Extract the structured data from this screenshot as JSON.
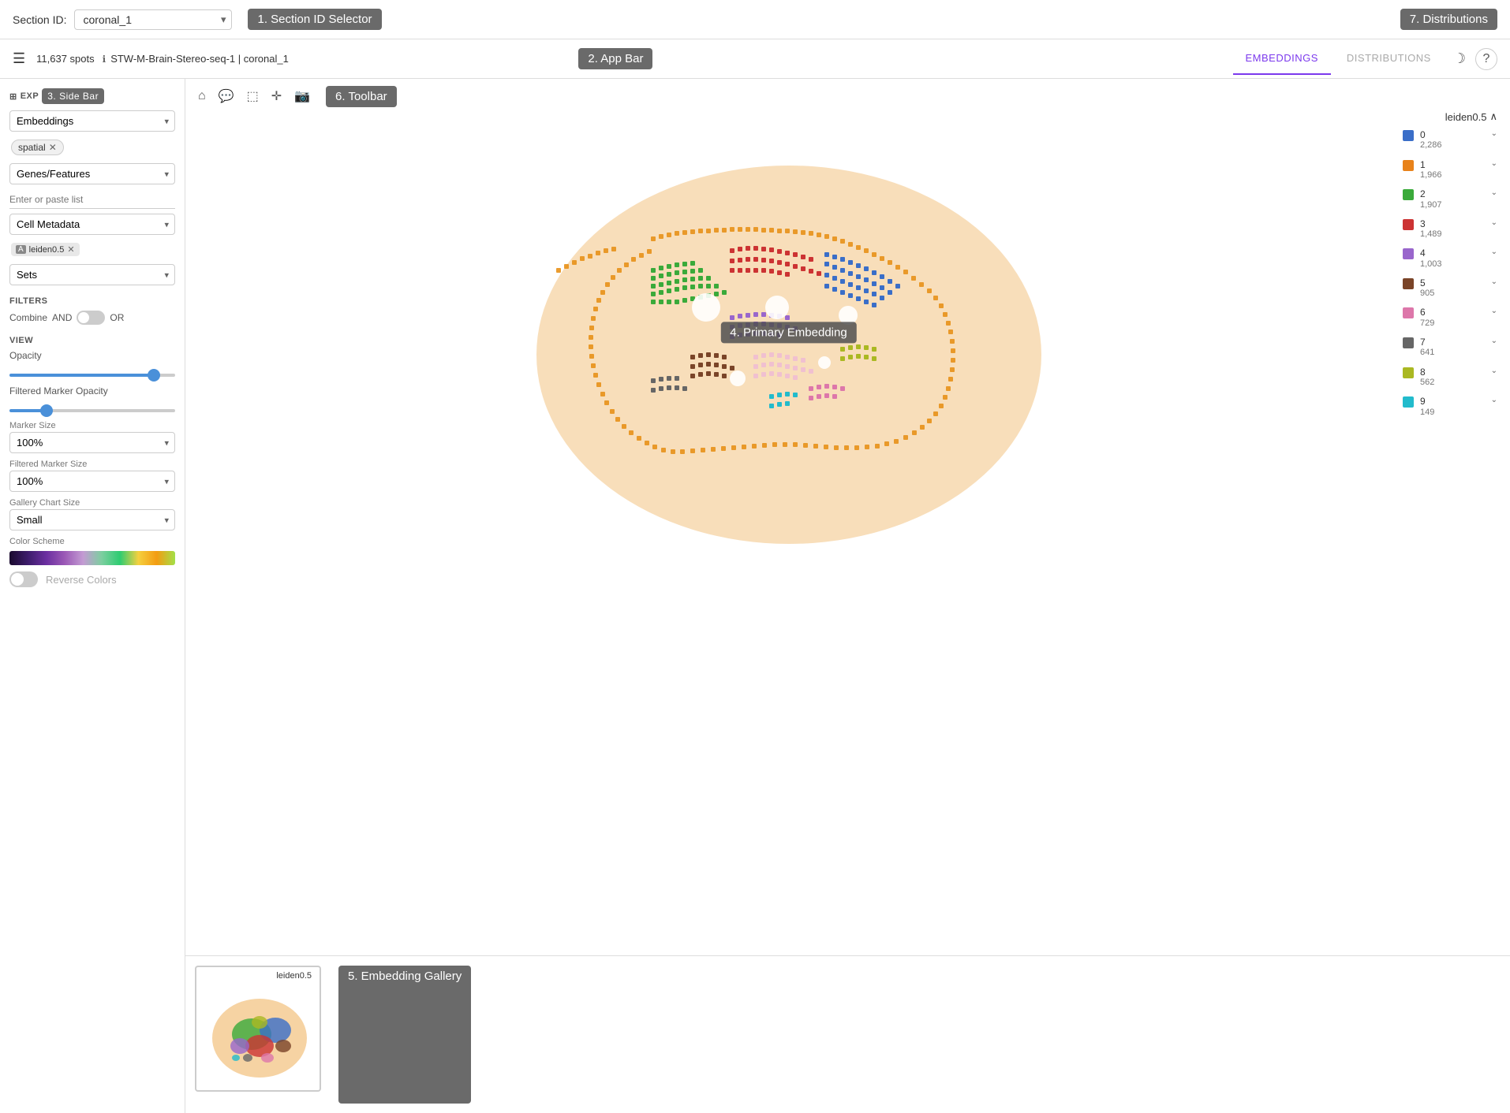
{
  "section_id_bar": {
    "label": "Section ID:",
    "selected": "coronal_1",
    "annotation": "1. Section ID Selector"
  },
  "top_right_annotation": "7. Distributions",
  "app_bar": {
    "spots": "11,637 spots",
    "info_text": "STW-M-Brain-Stereo-seq-1 | coronal_1",
    "annotation": "2. App Bar",
    "tabs": [
      {
        "label": "EMBEDDINGS",
        "active": true
      },
      {
        "label": "DISTRIBUTIONS",
        "active": false
      }
    ]
  },
  "sidebar": {
    "title": "EXP",
    "annotation": "3. Side Bar",
    "embeddings_label": "Embeddings",
    "tag_spatial": "spatial",
    "genes_label": "Genes/Features",
    "genes_placeholder": "Enter or paste list",
    "cell_metadata_label": "Cell Metadata",
    "cell_chip": "leiden0.5",
    "sets_label": "Sets",
    "filters_label": "FILTERS",
    "combine_label": "Combine",
    "and_label": "AND",
    "or_label": "OR",
    "view_label": "VIEW",
    "opacity_label": "Opacity",
    "filtered_opacity_label": "Filtered Marker Opacity",
    "marker_size_label": "Marker Size",
    "marker_size_value": "100%",
    "filtered_marker_size_label": "Filtered Marker Size",
    "filtered_marker_size_value": "100%",
    "gallery_chart_size_label": "Gallery Chart Size",
    "gallery_chart_size_value": "Small",
    "color_scheme_label": "Color Scheme",
    "reverse_colors_label": "Reverse Colors"
  },
  "toolbar": {
    "annotation": "6. Toolbar"
  },
  "primary_embedding": {
    "annotation": "4. Primary Embedding"
  },
  "legend": {
    "title": "leiden0.5",
    "items": [
      {
        "id": "0",
        "count": "2,286",
        "color": "#3a6ec8"
      },
      {
        "id": "1",
        "count": "1,966",
        "color": "#e8821a"
      },
      {
        "id": "2",
        "count": "1,907",
        "color": "#3aaa3a"
      },
      {
        "id": "3",
        "count": "1,489",
        "color": "#cc3333"
      },
      {
        "id": "4",
        "count": "1,003",
        "color": "#9966cc"
      },
      {
        "id": "5",
        "count": "905",
        "color": "#7a4428"
      },
      {
        "id": "6",
        "count": "729",
        "color": "#dd77aa"
      },
      {
        "id": "7",
        "count": "641",
        "color": "#666666"
      },
      {
        "id": "8",
        "count": "562",
        "color": "#aab822"
      },
      {
        "id": "9",
        "count": "149",
        "color": "#22bbcc"
      }
    ]
  },
  "gallery": {
    "annotation": "5. Embedding Gallery",
    "thumb_label": "leiden0.5"
  }
}
